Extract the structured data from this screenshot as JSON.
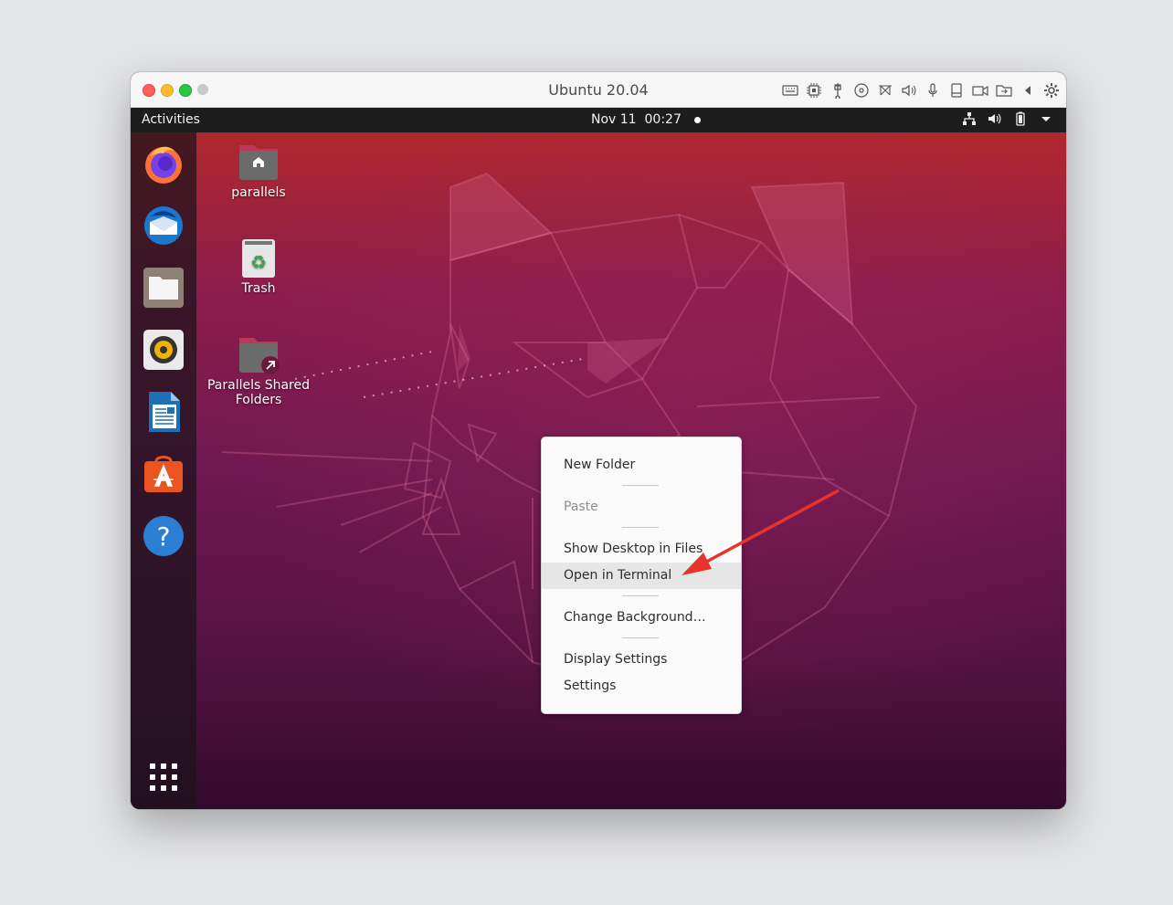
{
  "window": {
    "title": "Ubuntu 20.04",
    "toolbar_icons": [
      "keyboard-icon",
      "cpu-icon",
      "usb-icon",
      "cd-icon",
      "network-icon",
      "sound-icon",
      "microphone-icon",
      "hdd-icon",
      "camera-icon",
      "shared-folder-icon",
      "collapse-icon",
      "gear-icon"
    ]
  },
  "topbar": {
    "activities": "Activities",
    "date": "Nov 11",
    "time": "00:27",
    "tray_icons": [
      "network-icon",
      "volume-icon",
      "battery-icon",
      "chevron-down-icon"
    ]
  },
  "dock": {
    "apps": [
      "Firefox",
      "Thunderbird",
      "Files",
      "Rhythmbox",
      "LibreOffice Writer",
      "Ubuntu Software",
      "Help"
    ],
    "show_apps": "show-applications-icon"
  },
  "desktop_icons": [
    {
      "label": "parallels"
    },
    {
      "label": "Trash"
    },
    {
      "label": "Parallels Shared Folders"
    }
  ],
  "context_menu": {
    "items": [
      {
        "label": "New Folder"
      },
      {
        "label": "Paste"
      },
      {
        "label": "Show Desktop in Files"
      },
      {
        "label": "Open in Terminal"
      },
      {
        "label": "Change Background…"
      },
      {
        "label": "Display Settings"
      },
      {
        "label": "Settings"
      }
    ]
  },
  "colors": {
    "accent_arrow": "#e8332b",
    "topbar": "#1d1d1d",
    "wallpaper_top": "#b0282e",
    "wallpaper_bottom": "#330a2b"
  }
}
